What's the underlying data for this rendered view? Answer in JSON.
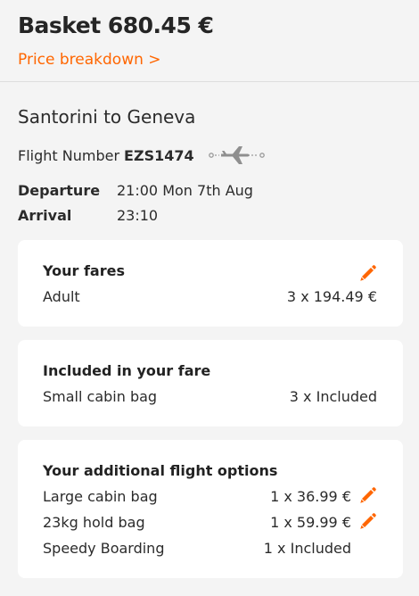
{
  "header": {
    "basket_title": "Basket 680.45 €",
    "price_breakdown_link": "Price breakdown >"
  },
  "flight": {
    "route": "Santorini to Geneva",
    "flight_number_label": "Flight Number",
    "flight_number": "EZS1474",
    "departure_label": "Departure",
    "departure_value": "21:00 Mon 7th Aug",
    "arrival_label": "Arrival",
    "arrival_value": "23:10"
  },
  "fares_card": {
    "title": "Your fares",
    "items": [
      {
        "label": "Adult",
        "value": "3 x 194.49 €"
      }
    ]
  },
  "included_card": {
    "title": "Included in your fare",
    "items": [
      {
        "label": "Small cabin bag",
        "value": "3 x Included"
      }
    ]
  },
  "options_card": {
    "title": "Your additional flight options",
    "items": [
      {
        "label": "Large cabin bag",
        "value": "1 x 36.99 €"
      },
      {
        "label": "23kg hold bag",
        "value": "1 x 59.99 €"
      },
      {
        "label": "Speedy Boarding",
        "value": "1 x Included"
      }
    ]
  },
  "colors": {
    "accent": "#ff6600",
    "background": "#f4f4f4",
    "card": "#ffffff",
    "text": "#2b2b2b"
  },
  "icons": {
    "plane": "plane-icon",
    "edit": "pencil-icon"
  }
}
